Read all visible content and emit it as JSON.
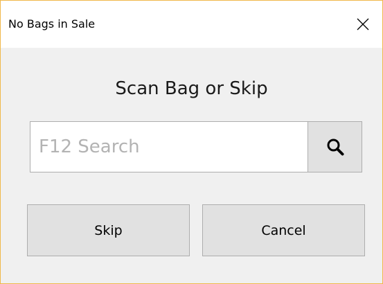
{
  "window": {
    "title": "No Bags in Sale",
    "accent_border": "#f0b84a"
  },
  "dialog": {
    "heading": "Scan Bag or Skip",
    "search": {
      "placeholder": "F12 Search",
      "value": "",
      "icon": "search-icon"
    },
    "buttons": {
      "skip_label": "Skip",
      "cancel_label": "Cancel"
    }
  }
}
